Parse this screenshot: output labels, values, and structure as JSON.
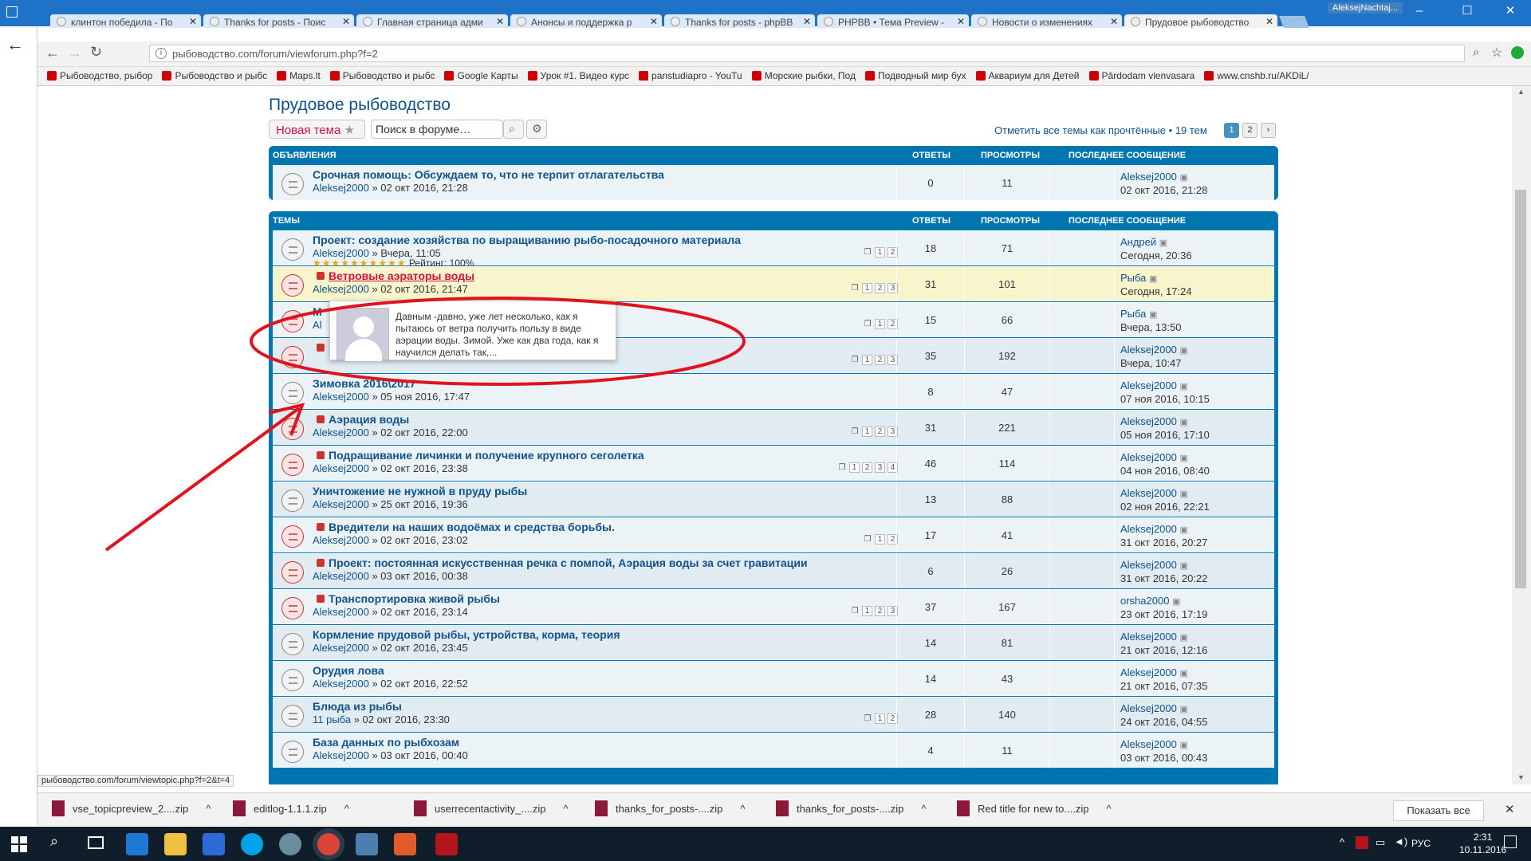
{
  "browser": {
    "tabs": [
      {
        "label": "клинтон победила - По"
      },
      {
        "label": "Thanks for posts - Поис"
      },
      {
        "label": "Главная страница адми"
      },
      {
        "label": "Анонсы и поддержка р"
      },
      {
        "label": "Thanks for posts - phpBB"
      },
      {
        "label": "PHPBB • Тема Preview -"
      },
      {
        "label": "Новости о изменениях"
      },
      {
        "label": "Прудовое рыбоводство"
      }
    ],
    "window_user": "AleksejNachtaj...",
    "url": "рыбоводство.com/forum/viewforum.php?f=2",
    "bookmarks": [
      "Рыбоводство, рыбор",
      "Рыбоводство и рыбс",
      "Maps.lt",
      "Рыбоводство и рыбс",
      "Google Карты",
      "Урок #1. Видео курс",
      "panstudiapro - YouTu",
      "Морские рыбки, Под",
      "Подводный мир бух",
      "Аквариум для Детей",
      "Pārdodam vienvasara",
      "www.cnshb.ru/AKDiL/"
    ],
    "status_url": "рыбоводство.com/forum/viewtopic.php?f=2&t=4"
  },
  "forum": {
    "title": "Прудовое рыбоводство",
    "new_topic": "Новая тема",
    "search_placeholder": "Поиск в форуме…",
    "mark_read": "Отметить все темы как прочтённые • 19 тем",
    "pages": [
      "1",
      "2"
    ],
    "announcements": {
      "header": "Объявления",
      "col_replies": "Ответы",
      "col_views": "Просмотры",
      "col_last": "Последнее сообщение",
      "rows": [
        {
          "title": "Срочная помощь: Обсуждаем то, что не терпит отлагательства",
          "author": "Aleksej2000",
          "date": "» 02 окт 2016, 21:28",
          "replies": "0",
          "views": "11",
          "last_author": "Aleksej2000",
          "last_date": "02 окт 2016, 21:28"
        }
      ]
    },
    "topics": {
      "header": "Темы",
      "col_replies": "Ответы",
      "col_views": "Просмотры",
      "col_last": "Последнее сообщение",
      "rows": [
        {
          "title": "Проект: создание хозяйства по выращиванию рыбо-посадочного материала",
          "author": "Aleksej2000",
          "date": "» Вчера, 11:05",
          "rating": "Рейтинг: 100%",
          "replies": "18",
          "views": "71",
          "last_author": "Андрей",
          "last_date": "Сегодня, 20:36",
          "pages": [
            "1",
            "2"
          ]
        },
        {
          "title": "Ветровые аэраторы воды",
          "author": "Aleksej2000",
          "date": "» 02 окт 2016, 21:47",
          "replies": "31",
          "views": "101",
          "last_author": "Рыба",
          "last_date": "Сегодня, 17:24",
          "pages": [
            "1",
            "2",
            "3"
          ]
        },
        {
          "title": "М",
          "author": "Al",
          "date": "",
          "replies": "15",
          "views": "66",
          "last_author": "Рыба",
          "last_date": "Вчера, 13:50",
          "pages": [
            "1",
            "2"
          ]
        },
        {
          "title": "ка",
          "author": "",
          "date": "",
          "replies": "35",
          "views": "192",
          "last_author": "Aleksej2000",
          "last_date": "Вчера, 10:47",
          "pages": [
            "1",
            "2",
            "3"
          ]
        },
        {
          "title": "Зимовка 2016\\2017",
          "author": "Aleksej2000",
          "date": "» 05 ноя 2016, 17:47",
          "replies": "8",
          "views": "47",
          "last_author": "Aleksej2000",
          "last_date": "07 ноя 2016, 10:15",
          "pages": []
        },
        {
          "title": "Аэрация воды",
          "author": "Aleksej2000",
          "date": "» 02 окт 2016, 22:00",
          "replies": "31",
          "views": "221",
          "last_author": "Aleksej2000",
          "last_date": "05 ноя 2016, 17:10",
          "pages": [
            "1",
            "2",
            "3"
          ]
        },
        {
          "title": "Подращивание личинки и получение крупного сеголетка",
          "author": "Aleksej2000",
          "date": "» 02 окт 2016, 23:38",
          "replies": "46",
          "views": "114",
          "last_author": "Aleksej2000",
          "last_date": "04 ноя 2016, 08:40",
          "pages": [
            "1",
            "2",
            "3",
            "4"
          ]
        },
        {
          "title": "Уничтожение не нужной в пруду рыбы",
          "author": "Aleksej2000",
          "date": "» 25 окт 2016, 19:36",
          "replies": "13",
          "views": "88",
          "last_author": "Aleksej2000",
          "last_date": "02 ноя 2016, 22:21",
          "pages": []
        },
        {
          "title": "Вредители на наших водоёмах и средства борьбы.",
          "author": "Aleksej2000",
          "date": "» 02 окт 2016, 23:02",
          "replies": "17",
          "views": "41",
          "last_author": "Aleksej2000",
          "last_date": "31 окт 2016, 20:27",
          "pages": [
            "1",
            "2"
          ]
        },
        {
          "title": "Проект: постоянная искусственная речка с помпой, Аэрация воды за счет гравитации",
          "author": "Aleksej2000",
          "date": "» 03 окт 2016, 00:38",
          "replies": "6",
          "views": "26",
          "last_author": "Aleksej2000",
          "last_date": "31 окт 2016, 20:22",
          "pages": []
        },
        {
          "title": "Транспортировка живой рыбы",
          "author": "Aleksej2000",
          "date": "» 02 окт 2016, 23:14",
          "replies": "37",
          "views": "167",
          "last_author": "orsha2000",
          "last_date": "23 окт 2016, 17:19",
          "pages": [
            "1",
            "2",
            "3"
          ]
        },
        {
          "title": "Кормление прудовой рыбы, устройства, корма, теория",
          "author": "Aleksej2000",
          "date": "» 02 окт 2016, 23:45",
          "replies": "14",
          "views": "81",
          "last_author": "Aleksej2000",
          "last_date": "21 окт 2016, 12:16",
          "pages": []
        },
        {
          "title": "Орудия лова",
          "author": "Aleksej2000",
          "date": "» 02 окт 2016, 22:52",
          "replies": "14",
          "views": "43",
          "last_author": "Aleksej2000",
          "last_date": "21 окт 2016, 07:35",
          "pages": []
        },
        {
          "title": "Блюда из рыбы",
          "author": "11 рыба",
          "date": "» 02 окт 2016, 23:30",
          "replies": "28",
          "views": "140",
          "last_author": "Aleksej2000",
          "last_date": "24 окт 2016, 04:55",
          "pages": [
            "1",
            "2"
          ]
        },
        {
          "title": "База данных по рыбхозам",
          "author": "Aleksej2000",
          "date": "» 03 окт 2016, 00:40",
          "replies": "4",
          "views": "11",
          "last_author": "Aleksej2000",
          "last_date": "03 окт 2016, 00:43",
          "pages": []
        }
      ]
    },
    "tooltip": "Давным -давно, уже лет несколько, как я пытаюсь от ветра получить пользу в виде аэрации воды. Зимой. Уже как два года, как я научился делать так,..."
  },
  "downloads": {
    "items": [
      "vse_topicpreview_2....zip",
      "editlog-1.1.1.zip",
      "userrecentactivity_....zip",
      "thanks_for_posts-....zip",
      "thanks_for_posts-....zip",
      "Red title for new to....zip"
    ],
    "show_all": "Показать все"
  },
  "taskbar": {
    "lang": "РУС",
    "time": "2:31",
    "date": "10.11.2016"
  },
  "colors": {
    "accent": "#0076b1",
    "link": "#105289",
    "highlight_row": "#f8f4cb",
    "annotation": "#e0141e"
  }
}
